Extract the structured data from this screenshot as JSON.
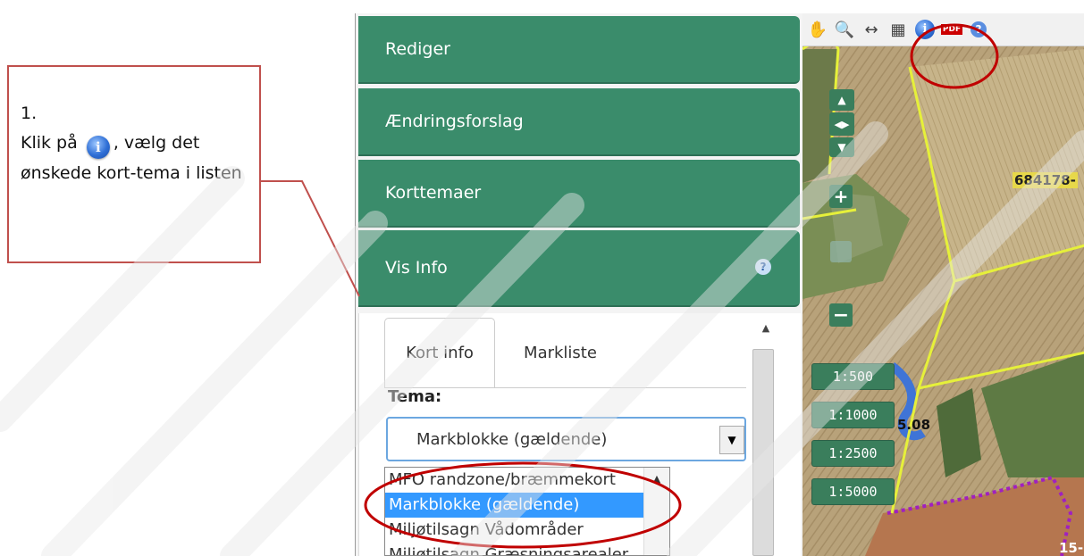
{
  "callout": {
    "step": "1.",
    "text_before_icon": "Klik på",
    "text_after_icon": ", vælg det ønskede kort-tema i listen",
    "icon": "info-icon"
  },
  "panel": {
    "headers": [
      {
        "label": "Rediger"
      },
      {
        "label": "Ændringsforslag"
      },
      {
        "label": "Korttemaer"
      },
      {
        "label": "Vis Info"
      }
    ],
    "tabs": {
      "active": "Kort info",
      "inactive": "Markliste"
    },
    "tema_label": "Tema:",
    "select_value": "Markblokke (gældende)",
    "dropdown_options": [
      "MFO randzone/bræmmekort",
      "Markblokke (gældende)",
      "Miljøtilsagn Vådområder",
      "Miljøtilsagn Græsningsarealer"
    ],
    "selected_option_index": 1
  },
  "map": {
    "toolbar_icons": [
      "pan-icon",
      "zoom-icon",
      "measure-icon",
      "legend-icon",
      "info-icon",
      "print-pdf-icon",
      "help-icon"
    ],
    "pdf_label": "PDF",
    "scales": [
      "1:500",
      "1:1000",
      "1:2500",
      "1:5000"
    ],
    "labels": [
      "684178-",
      "5.08",
      "15-"
    ]
  },
  "colors": {
    "panel_green": "#3a8c6b",
    "callout_red": "#c0504d",
    "highlight_red": "#c00000",
    "select_blue": "#3399ff"
  }
}
